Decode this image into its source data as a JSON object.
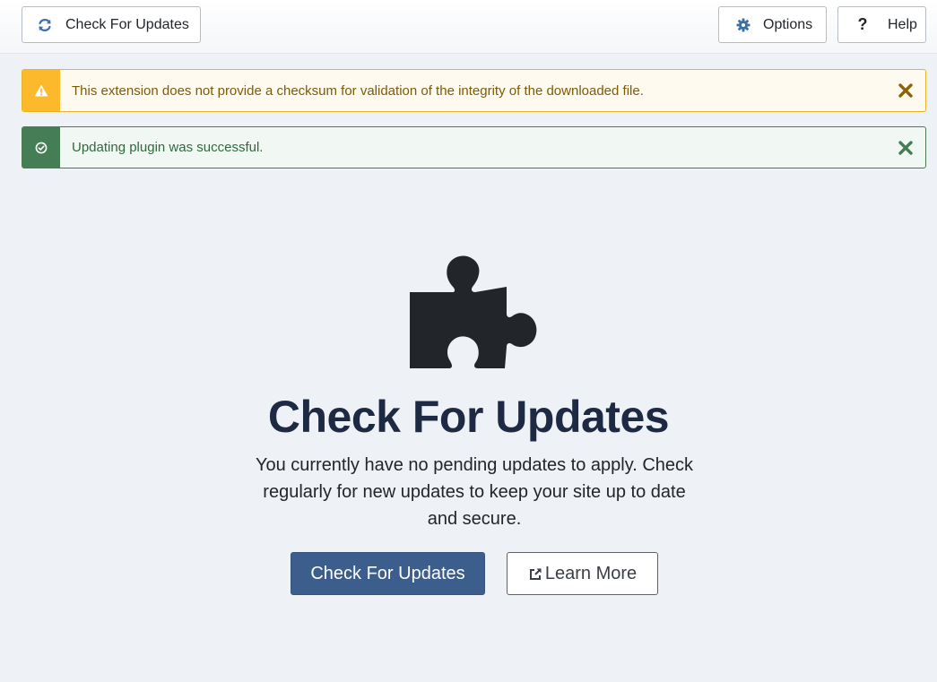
{
  "toolbar": {
    "check_updates_label": "Check For Updates",
    "check_updates_icon": "sync-icon",
    "options_label": "Options",
    "options_icon": "gear-icon",
    "help_label": "Help",
    "help_icon": "question-icon"
  },
  "alerts": {
    "warning": {
      "icon": "warning-icon",
      "message": "This extension does not provide a checksum for validation of the integrity of the downloaded file.",
      "close_icon": "close-icon"
    },
    "success": {
      "icon": "check-circle-icon",
      "message": "Updating plugin was successful.",
      "close_icon": "close-icon"
    }
  },
  "empty_state": {
    "icon": "puzzle-piece-icon",
    "title": "Check For Updates",
    "description": "You currently have no pending updates to apply. Check regularly for new updates to keep your site up to date and secure.",
    "primary_button": "Check For Updates",
    "secondary_button": "Learn More",
    "secondary_icon": "external-link-icon"
  },
  "colors": {
    "primary": "#3b5e8c",
    "warning": "#fcb92b",
    "success": "#457d54",
    "title": "#1e2a44",
    "background": "#eef2f6"
  }
}
